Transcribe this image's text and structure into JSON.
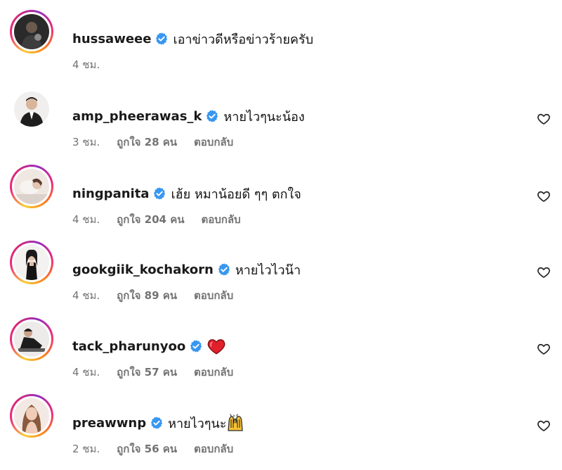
{
  "colors": {
    "verified_blue": "#3897f0",
    "meta_gray": "#737373",
    "heart_red": "#e0202a"
  },
  "comments": [
    {
      "username": "hussaweee",
      "text": "เอาข่าวดีหรือข่าวร้ายครับ",
      "time": "4 ชม.",
      "likes": "",
      "reply": "",
      "emoji": "",
      "has_like_button": false
    },
    {
      "username": "amp_pheerawas_k",
      "text": "หายไวๆนะน้อง",
      "time": "3 ชม.",
      "likes": "ถูกใจ 28 คน",
      "reply": "ตอบกลับ",
      "emoji": "",
      "has_like_button": true
    },
    {
      "username": "ningpanita",
      "text": "เฮ้ย หมาน้อยดี ๆๆ ตกใจ",
      "time": "4 ชม.",
      "likes": "ถูกใจ 204 คน",
      "reply": "ตอบกลับ",
      "emoji": "",
      "has_like_button": true
    },
    {
      "username": "gookgiik_kochakorn",
      "text": "หายไวไวน๊า",
      "time": "4 ชม.",
      "likes": "ถูกใจ 89 คน",
      "reply": "ตอบกลับ",
      "emoji": "",
      "has_like_button": true
    },
    {
      "username": "tack_pharunyoo",
      "text": "",
      "time": "4 ชม.",
      "likes": "ถูกใจ 57 คน",
      "reply": "ตอบกลับ",
      "emoji": "red-heart-emoji",
      "has_like_button": true
    },
    {
      "username": "preawwnp",
      "text": "หายไวๆนะ",
      "time": "2 ชม.",
      "likes": "ถูกใจ 56 คน",
      "reply": "ตอบกลับ",
      "emoji": "raising-hands-emoji",
      "has_like_button": true
    }
  ]
}
